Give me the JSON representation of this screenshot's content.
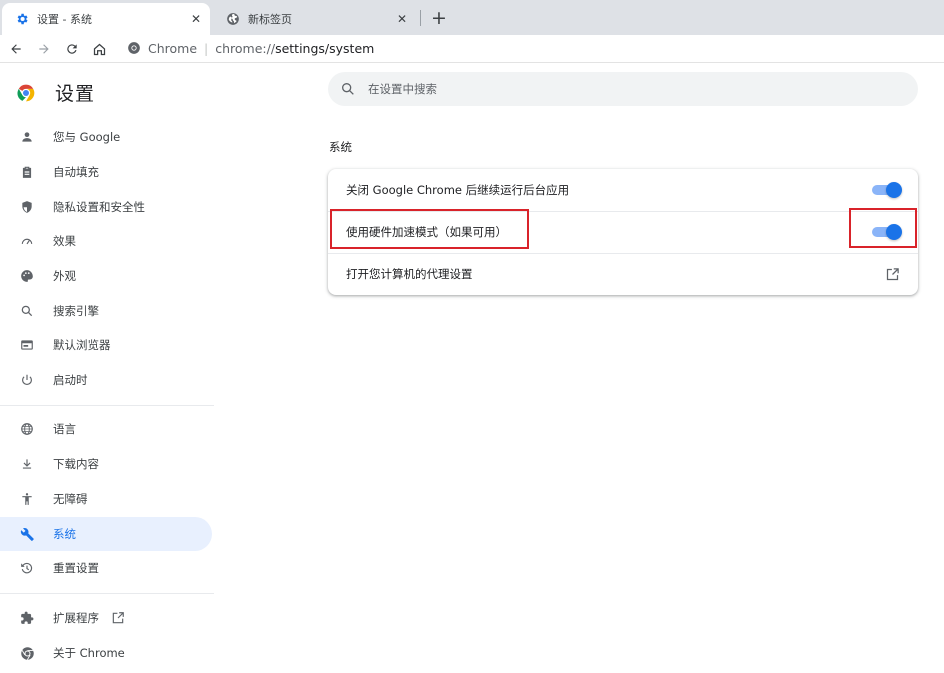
{
  "tabs": [
    {
      "title": "设置 - 系统",
      "icon": "gear-icon",
      "active": true,
      "close": "✕"
    },
    {
      "title": "新标签页",
      "icon": "globe-icon",
      "active": false,
      "close": "✕"
    }
  ],
  "new_tab": "+",
  "toolbar": {
    "back": "back-arrow-icon",
    "forward": "forward-arrow-icon",
    "reload": "reload-icon",
    "home": "home-icon"
  },
  "omnibox": {
    "chip_label": "Chrome",
    "separator": "|",
    "url_scheme": "chrome://",
    "url_path": "settings/system"
  },
  "header": {
    "title": "设置"
  },
  "search": {
    "placeholder": "在设置中搜索"
  },
  "sidebar": {
    "items": [
      {
        "label": "您与 Google",
        "icon": "person-icon"
      },
      {
        "label": "自动填充",
        "icon": "clipboard-icon"
      },
      {
        "label": "隐私设置和安全性",
        "icon": "shield-icon"
      },
      {
        "label": "效果",
        "icon": "speedometer-icon"
      },
      {
        "label": "外观",
        "icon": "palette-icon"
      },
      {
        "label": "搜索引擎",
        "icon": "search-icon"
      },
      {
        "label": "默认浏览器",
        "icon": "browser-icon"
      },
      {
        "label": "启动时",
        "icon": "power-icon"
      },
      {
        "label": "语言",
        "icon": "globe-icon"
      },
      {
        "label": "下载内容",
        "icon": "download-icon"
      },
      {
        "label": "无障碍",
        "icon": "accessibility-icon"
      },
      {
        "label": "系统",
        "icon": "wrench-icon",
        "selected": true
      },
      {
        "label": "重置设置",
        "icon": "history-icon"
      },
      {
        "label": "扩展程序",
        "icon": "puzzle-icon"
      },
      {
        "label": "关于 Chrome",
        "icon": "chrome-logo-icon"
      }
    ]
  },
  "main": {
    "section_title": "系统",
    "rows": [
      {
        "label": "关闭 Google Chrome 后继续运行后台应用",
        "control": "toggle",
        "on": true
      },
      {
        "label": "使用硬件加速模式（如果可用）",
        "control": "toggle",
        "on": true
      },
      {
        "label": "打开您计算机的代理设置",
        "control": "open-in-new-icon"
      }
    ]
  },
  "colors": {
    "accent": "#1a73e8",
    "toggle_track": "#8ab4f8",
    "selected_bg": "#e8f0fe",
    "highlight_box": "#d9232a"
  }
}
